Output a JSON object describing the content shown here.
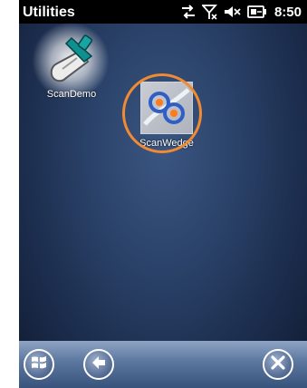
{
  "statusbar": {
    "title": "Utilities",
    "clock": "8:50",
    "icons": [
      "data-transfer-icon",
      "no-signal-icon",
      "speaker-muted-icon",
      "battery-icon"
    ]
  },
  "desktop": {
    "icons": [
      {
        "label": "ScanDemo",
        "icon": "scanner-icon"
      },
      {
        "label": "ScanWedge",
        "icon": "scanwedge-icon"
      }
    ]
  },
  "taskbar": {
    "buttons": [
      "start-icon",
      "back-icon",
      "close-icon"
    ]
  },
  "colors": {
    "statusbar": "#000000",
    "highlight": "#f08a33",
    "desktop": "#2b436a"
  }
}
